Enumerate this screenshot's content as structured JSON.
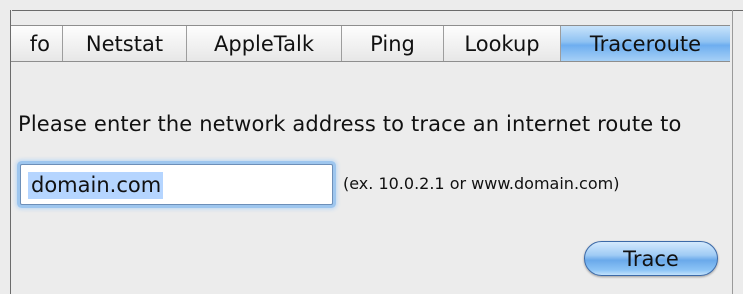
{
  "tabs": [
    {
      "label": "fo",
      "selected": false
    },
    {
      "label": "Netstat",
      "selected": false
    },
    {
      "label": "AppleTalk",
      "selected": false
    },
    {
      "label": "Ping",
      "selected": false
    },
    {
      "label": "Lookup",
      "selected": false
    },
    {
      "label": "Traceroute",
      "selected": true
    }
  ],
  "prompt_text": "Please enter the network address to trace an internet route to",
  "address_field": {
    "value": "domain.com",
    "selected_text": "domain.com"
  },
  "hint_text": "(ex. 10.0.2.1 or www.domain.com)",
  "trace_button_label": "Trace",
  "colors": {
    "selected_tab": "#8fc2f2",
    "focus_ring": "#9ec6ee",
    "selection_highlight": "#b5d5ff",
    "button_blue": "#6aa9ea"
  }
}
